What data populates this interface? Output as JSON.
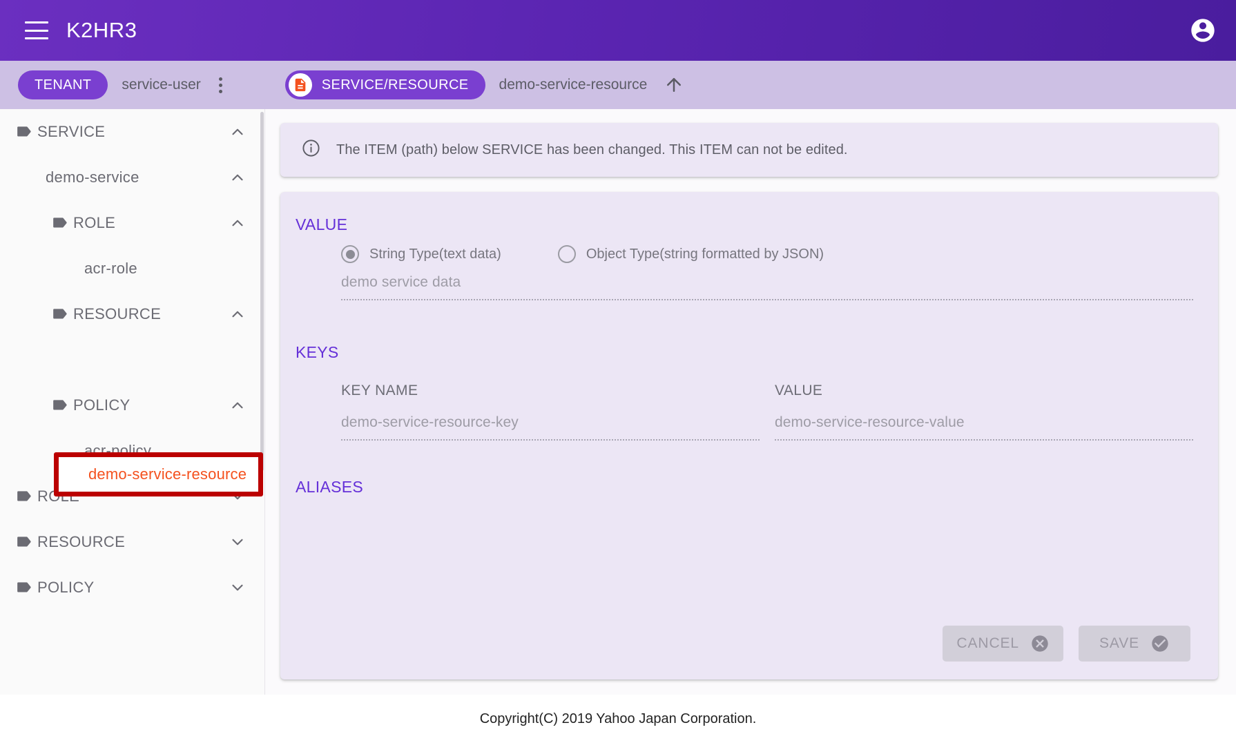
{
  "appbar": {
    "menu_icon": "hamburger-icon",
    "title": "K2HR3",
    "account_icon": "account-circle-icon"
  },
  "breadcrumb": {
    "tenant_chip": "TENANT",
    "tenant_name": "service-user",
    "tenant_menu_icon": "more-vert-icon",
    "resource_chip": "SERVICE/RESOURCE",
    "resource_chip_icon": "document-icon",
    "resource_name": "demo-service-resource",
    "up_icon": "arrow-upward-icon"
  },
  "sidebar": {
    "items": [
      {
        "label": "SERVICE",
        "level": 0,
        "icon": "tag-icon",
        "chevron": "chevron-up",
        "selected": false
      },
      {
        "label": "demo-service",
        "level": 1,
        "icon": "",
        "chevron": "chevron-up",
        "selected": false
      },
      {
        "label": "ROLE",
        "level": 2,
        "icon": "tag-icon",
        "chevron": "chevron-up",
        "selected": false
      },
      {
        "label": "acr-role",
        "level": 3,
        "icon": "",
        "chevron": "",
        "selected": false
      },
      {
        "label": "RESOURCE",
        "level": 2,
        "icon": "tag-icon",
        "chevron": "chevron-up",
        "selected": false
      },
      {
        "label": "demo-service-resource",
        "level": 3,
        "icon": "",
        "chevron": "",
        "selected": true
      },
      {
        "label": "POLICY",
        "level": 2,
        "icon": "tag-icon",
        "chevron": "chevron-up",
        "selected": false
      },
      {
        "label": "acr-policy",
        "level": 3,
        "icon": "",
        "chevron": "",
        "selected": false
      },
      {
        "label": "ROLE",
        "level": 0,
        "icon": "tag-icon",
        "chevron": "chevron-down",
        "selected": false
      },
      {
        "label": "RESOURCE",
        "level": 0,
        "icon": "tag-icon",
        "chevron": "chevron-down",
        "selected": false
      },
      {
        "label": "POLICY",
        "level": 0,
        "icon": "tag-icon",
        "chevron": "chevron-down",
        "selected": false
      }
    ],
    "highlight_label": "demo-service-resource",
    "highlight_color": "#bb0000",
    "highlight_text_color": "#f4511e"
  },
  "notice": {
    "icon": "info-outline-icon",
    "text": "The ITEM (path) below SERVICE has been changed. This ITEM can not be edited."
  },
  "form": {
    "value_section_title": "VALUE",
    "radio_string_label": "String Type(text data)",
    "radio_object_label": "Object Type(string formatted by JSON)",
    "radio_selected": "String Type(text data)",
    "value_input": "demo service data",
    "keys_section_title": "KEYS",
    "key_name_header": "KEY NAME",
    "key_value_header": "VALUE",
    "key_rows": [
      {
        "name": "demo-service-resource-key",
        "value": "demo-service-resource-value"
      }
    ],
    "aliases_section_title": "ALIASES",
    "cancel_label": "CANCEL",
    "cancel_icon": "cancel-circle-icon",
    "save_label": "SAVE",
    "save_icon": "check-circle-icon"
  },
  "footer": {
    "copyright": "Copyright(C) 2019 Yahoo Japan Corporation."
  },
  "colors": {
    "brand_purple": "#5b25b2",
    "chip_purple": "#7a3fd0",
    "crumbbar": "#cdc0e4",
    "card": "#ece6f5",
    "section_label": "#6530d8",
    "accent_orange": "#f4511e",
    "annotation_red": "#bb0000"
  }
}
